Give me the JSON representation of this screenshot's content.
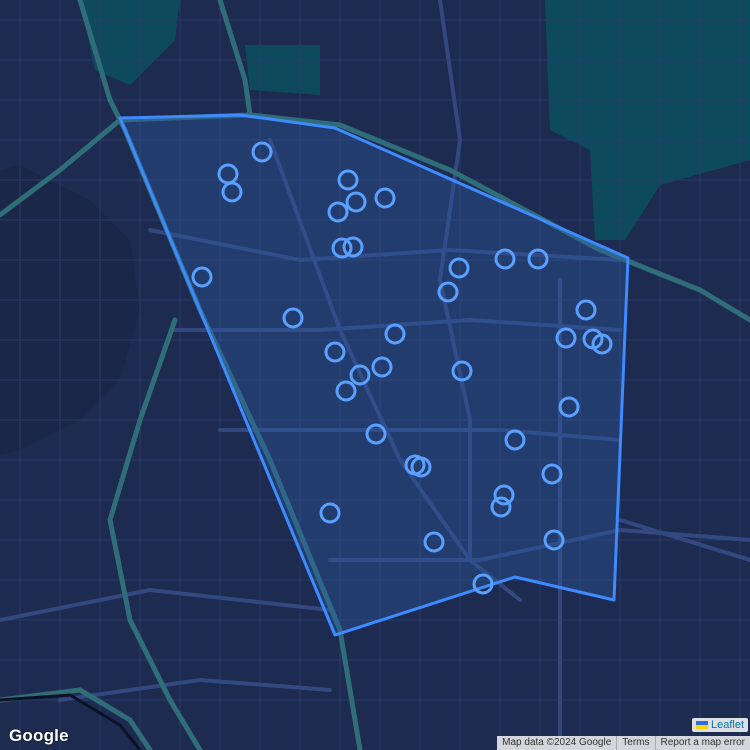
{
  "map": {
    "attribution": {
      "leaflet_label": "Leaflet",
      "map_data": "Map data ©2024 Google",
      "terms": "Terms",
      "report": "Report a map error"
    },
    "logo": "Google",
    "colors": {
      "background": "#1d2b4f",
      "water": "#0e4a5e",
      "roads": "#2c3f73",
      "highway": "#2f6e78",
      "polygon_stroke": "#3d8bff",
      "polygon_fill": "#2e5da6",
      "marker": "#5aa0ff"
    }
  }
}
